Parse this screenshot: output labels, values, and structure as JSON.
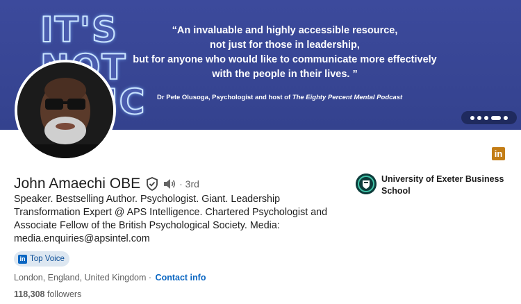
{
  "banner": {
    "bulb_line1": "IT'S",
    "bulb_line2": "NOT",
    "bulb_line3": "SIC",
    "quote_lines": [
      "“An invaluable and highly accessible resource,",
      "not just for those in leadership,",
      "but for anyone who would like to communicate more effectively",
      "with the people in their lives. ”"
    ],
    "attribution_prefix": "Dr Pete Olusoga, Psychologist and host of ",
    "attribution_show": "The Eighty Percent Mental Podcast",
    "carousel_icon": "more-dots-icon"
  },
  "profile": {
    "name": "John Amaechi OBE",
    "verified_icon": "verified-shield-icon",
    "pronunciation_icon": "speaker-icon",
    "degree": "· 3rd",
    "headline": "Speaker. Bestselling Author. Psychologist. Giant. Leadership Transformation Expert @ APS Intelligence. Chartered Psychologist and Associate Fellow of the British Psychological Society. Media: media.enquiries@apsintel.com",
    "badge": "Top Voice",
    "location": "London, England, United Kingdom ·",
    "contact_link": "Contact info",
    "followers_count": "118,308",
    "followers_label": "followers"
  },
  "organization": {
    "name": "University of Exeter Business School",
    "logo_icon": "university-crest-icon"
  },
  "colors": {
    "banner": "#3a489a",
    "link": "#0a66c2",
    "badge_bg": "#dde7f1",
    "linkedin_icon": "#c37d16"
  }
}
